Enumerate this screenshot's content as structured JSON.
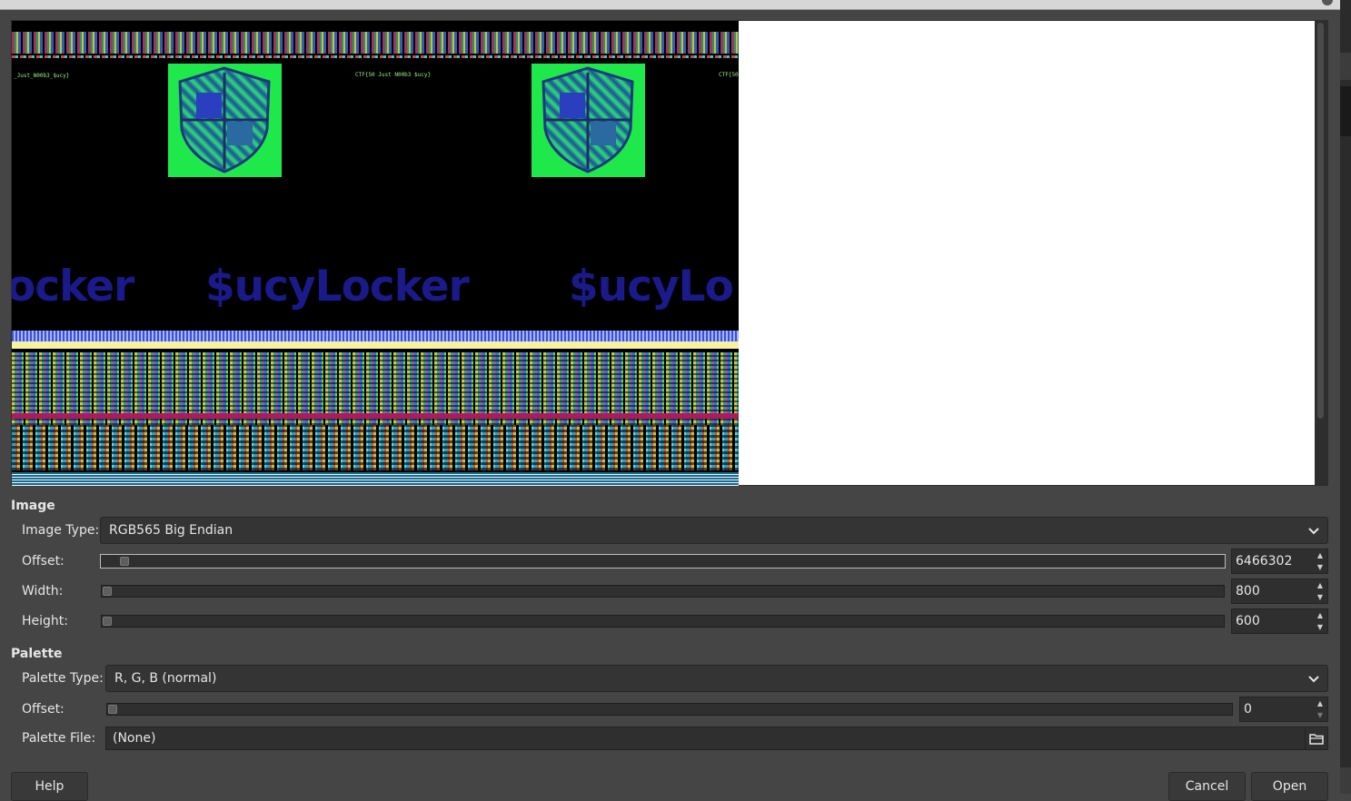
{
  "window": {
    "title": ""
  },
  "preview": {
    "raw_text_1": "CTF{50 Just N00b3 $ucy}",
    "raw_text_2": "_Just_N00b3_$ucy}",
    "raw_text_3": "CTF{50",
    "brand_text_1": "ocker",
    "brand_text_2": "$ucyLocker",
    "brand_text_3": "$ucyLo"
  },
  "image_section": {
    "title": "Image",
    "image_type_label": "Image Type:",
    "image_type_value": "RGB565 Big Endian",
    "offset_label": "Offset:",
    "offset_value": "6466302",
    "width_label": "Width:",
    "width_value": "800",
    "height_label": "Height:",
    "height_value": "600"
  },
  "palette_section": {
    "title": "Palette",
    "palette_type_label": "Palette Type:",
    "palette_type_value": "R, G, B (normal)",
    "offset_label": "Offset:",
    "offset_value": "0",
    "palette_file_label": "Palette File:",
    "palette_file_value": "(None)"
  },
  "buttons": {
    "help": "Help",
    "cancel": "Cancel",
    "open": "Open"
  },
  "icons": {
    "dropdown": "chevron-down-icon",
    "spin_up": "spin-up-icon",
    "spin_down": "spin-down-icon",
    "file_browse": "folder-icon",
    "preview_shield": "shield-icon"
  },
  "colors": {
    "dialog_bg": "#454545",
    "preview_bg": "#ffffff",
    "shield_box": "#1ee84a",
    "brand_text": "#1a1a8a"
  }
}
